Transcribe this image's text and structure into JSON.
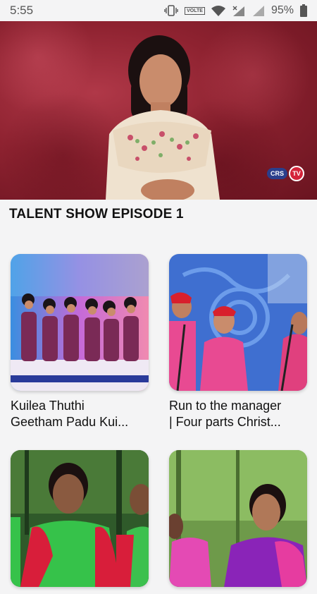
{
  "status_bar": {
    "time": "5:55",
    "volte": "VOLTE",
    "battery": "95%"
  },
  "video": {
    "logo_crs": "CRS",
    "logo_tv": "TV"
  },
  "page_title": "TALENT SHOW EPISODE 1",
  "videos": [
    {
      "title_line1": "Kuilea Thuthi",
      "title_line2": "Geetham Padu Kui..."
    },
    {
      "title_line1": "Run to the manager",
      "title_line2": "| Four parts Christ..."
    },
    {
      "title_line1": "",
      "title_line2": ""
    },
    {
      "title_line1": "",
      "title_line2": ""
    }
  ]
}
